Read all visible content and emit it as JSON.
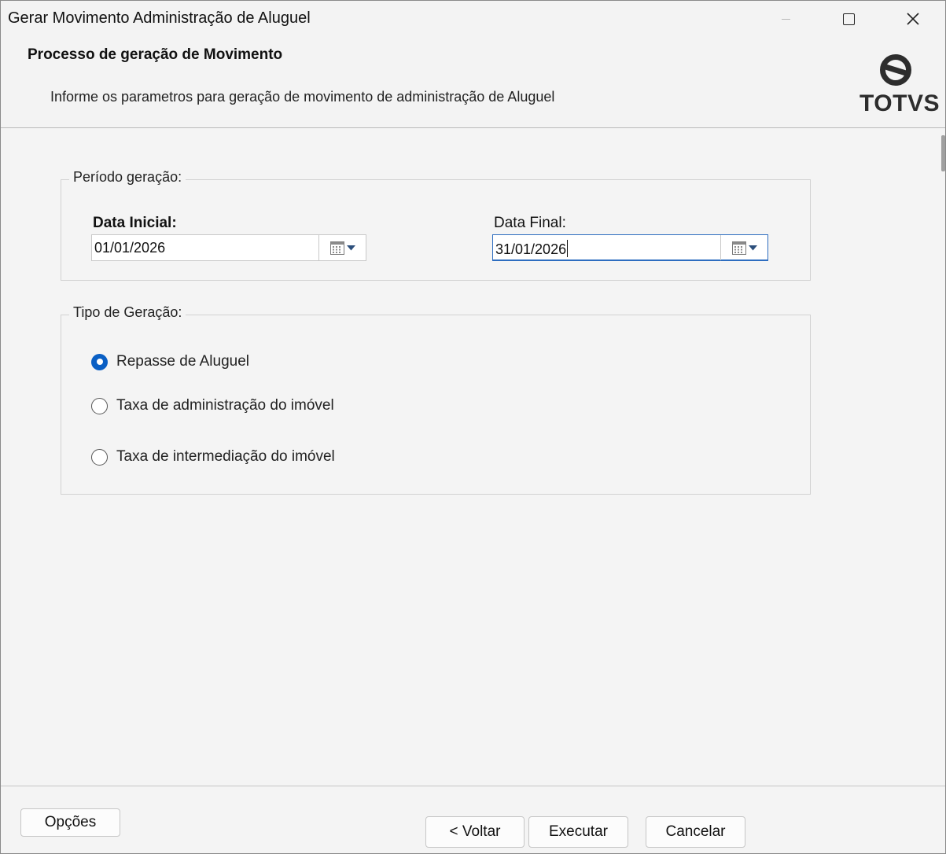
{
  "window": {
    "title": "Gerar Movimento Administração de Aluguel",
    "close_glyph": "✕"
  },
  "header": {
    "title": "Processo de geração de Movimento",
    "subtitle": "Informe os parametros para geração de movimento de administração de Aluguel",
    "logo_text": "TOTVS"
  },
  "periodo": {
    "legend": "Período geração:",
    "data_inicial": {
      "label": "Data Inicial:",
      "value": "01/01/2026"
    },
    "data_final": {
      "label": "Data Final:",
      "value": "31/01/2026"
    }
  },
  "tipo": {
    "legend": "Tipo de Geração:",
    "options": [
      {
        "label": "Repasse de Aluguel",
        "checked": true
      },
      {
        "label": "Taxa de administração do imóvel",
        "checked": false
      },
      {
        "label": "Taxa de intermediação do imóvel",
        "checked": false
      }
    ]
  },
  "footer": {
    "opcoes": "Opções",
    "voltar": "< Voltar",
    "executar": "Executar",
    "cancelar": "Cancelar"
  },
  "colors": {
    "accent": "#0a5fc4",
    "focus_border": "#2d6dc0",
    "background": "#f4f4f4"
  },
  "icons": [
    "minimize-icon",
    "maximize-icon",
    "close-icon",
    "totvs-logo-icon",
    "calendar-icon",
    "chevron-down-icon"
  ]
}
